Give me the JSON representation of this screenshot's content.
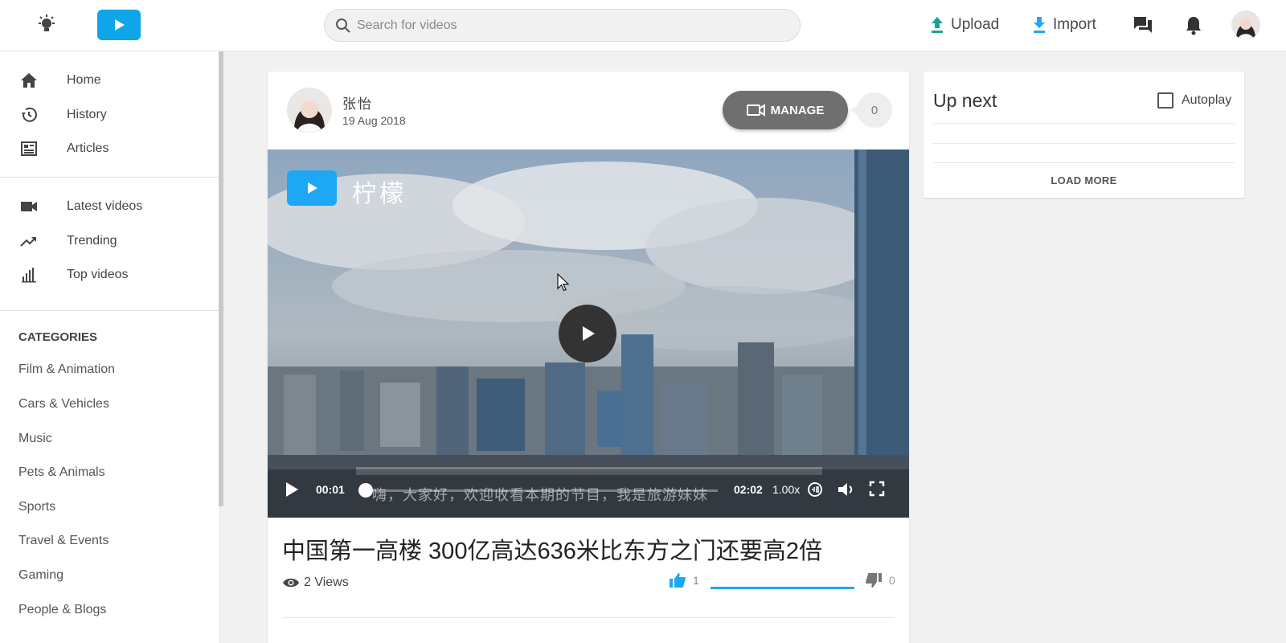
{
  "header": {
    "search_placeholder": "Search for videos",
    "upload_label": "Upload",
    "import_label": "Import"
  },
  "sidebar": {
    "nav_primary": [
      "Home",
      "History",
      "Articles"
    ],
    "nav_secondary": [
      "Latest videos",
      "Trending",
      "Top videos"
    ],
    "categories_title": "CATEGORIES",
    "categories": [
      "Film & Animation",
      "Cars & Vehicles",
      "Music",
      "Pets & Animals",
      "Sports",
      "Travel & Events",
      "Gaming",
      "People & Blogs"
    ]
  },
  "video_card": {
    "channel_name": "张怡",
    "date": "19 Aug 2018",
    "manage_label": "MANAGE",
    "comment_count": "0",
    "watermark_text": "柠檬",
    "current_time": "00:01",
    "duration": "02:02",
    "playback_rate": "1.00x",
    "subtitle": "嗨，大家好，欢迎收看本期的节目，我是旅游妹妹",
    "title": "中国第一高楼 300亿高达636米比东方之门还要高2倍",
    "views": "2 Views",
    "likes": "1",
    "dislikes": "0",
    "progress": 0.008
  },
  "up_next": {
    "title": "Up next",
    "autoplay_label": "Autoplay",
    "autoplay_checked": false,
    "load_more_label": "LOAD MORE"
  },
  "colors": {
    "accent": "#1ea7f5",
    "upload_icon": "#1aa39a",
    "import_icon": "#1ea7f5",
    "manage_button": "#6f6f6f"
  }
}
